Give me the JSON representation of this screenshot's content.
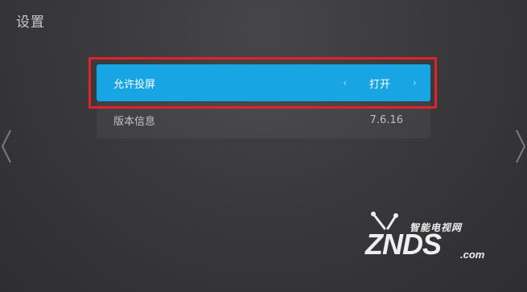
{
  "header": {
    "title": "设置"
  },
  "settings": {
    "items": [
      {
        "label": "允许投屏",
        "value": "打开",
        "prev_glyph": "‹",
        "next_glyph": "›"
      },
      {
        "label": "版本信息",
        "value": "7.6.16"
      }
    ]
  },
  "watermark": {
    "brand": "ZNDS",
    "subtitle": "智能电视网",
    "suffix": ".com"
  },
  "colors": {
    "accent": "#17a6e3",
    "highlight_frame": "#e0222b",
    "background": "#3a3a3d"
  },
  "icons": {
    "left_nav": "chevron-left-icon",
    "right_nav": "chevron-right-icon"
  }
}
